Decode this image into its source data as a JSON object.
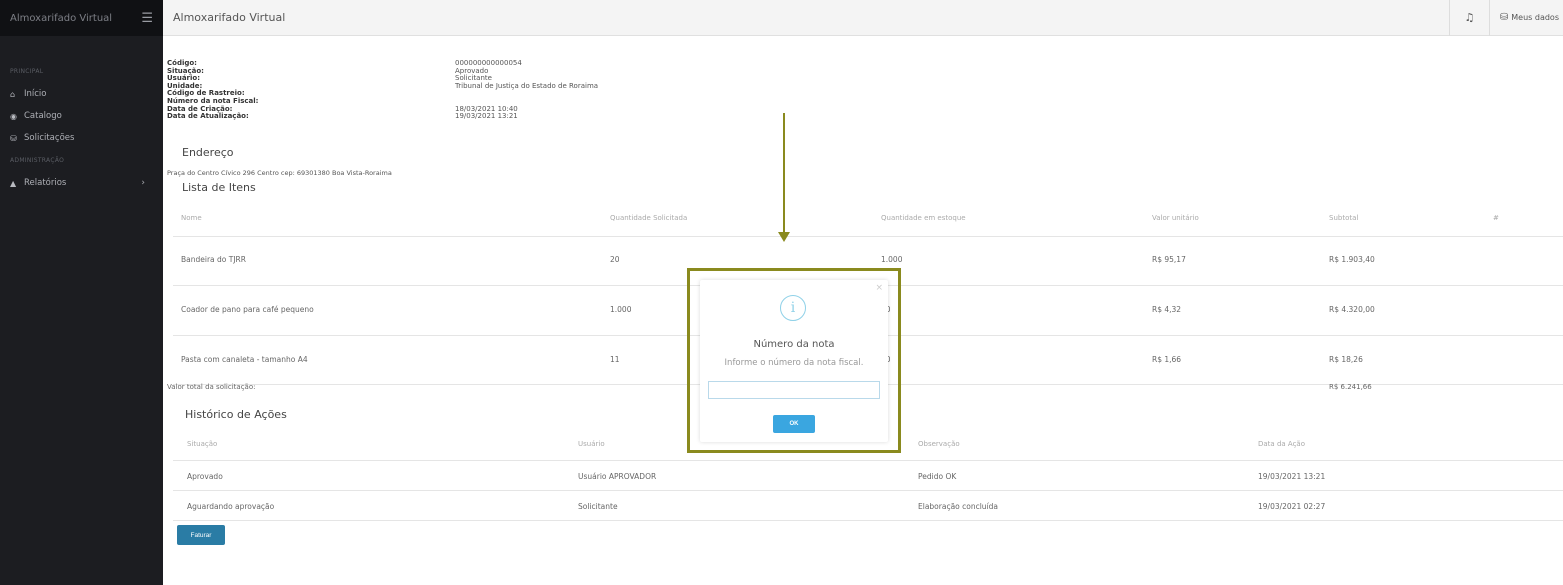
{
  "sidebar": {
    "app_name": "Almoxarifado Virtual",
    "section_principal": "PRINCIPAL",
    "section_admin": "ADMINISTRAÇÃO",
    "items": [
      {
        "label": "Início",
        "icon": "home-icon",
        "glyph": "⌂"
      },
      {
        "label": "Catalogo",
        "icon": "catalog-icon",
        "glyph": "◉"
      },
      {
        "label": "Solicitações",
        "icon": "basket-icon",
        "glyph": "⛁"
      },
      {
        "label": "Relatórios",
        "icon": "chart-icon",
        "glyph": "▲"
      }
    ]
  },
  "topbar": {
    "title": "Almoxarifado Virtual",
    "user_label": "Meus dados"
  },
  "details": {
    "labels": [
      "Código:",
      "Situação:",
      "Usuário:",
      "Unidade:",
      "Código de Rastreio:",
      "Número da nota Fiscal:",
      "Data de Criação:",
      "Data de Atualização:"
    ],
    "values": [
      "000000000000054",
      "Aprovado",
      "Solicitante",
      "Tribunal de Justiça do Estado de Roraima",
      "",
      "",
      "18/03/2021 10:40",
      "19/03/2021 13:21"
    ]
  },
  "endereco": {
    "title": "Endereço",
    "text": "Praça do Centro Cívico 296 Centro cep: 69301380 Boa Vista-Roraima"
  },
  "itens": {
    "title": "Lista de Itens",
    "headers": [
      "Nome",
      "Quantidade Solicitada",
      "Quantidade em estoque",
      "Valor unitário",
      "Subtotal",
      "#"
    ],
    "rows": [
      [
        "Bandeira do TJRR",
        "20",
        "1.000",
        "R$ 95,17",
        "R$ 1.903,40"
      ],
      [
        "Coador de pano para café pequeno",
        "1.000",
        "90",
        "R$ 4,32",
        "R$ 4.320,00"
      ],
      [
        "Pasta com canaleta - tamanho A4",
        "11",
        "70",
        "R$ 1,66",
        "R$ 18,26"
      ]
    ],
    "total_label": "Valor total da solicitação:",
    "total_value": "R$ 6.241,66"
  },
  "historico": {
    "title": "Histórico de Ações",
    "headers": [
      "Situação",
      "Usuário",
      "Observação",
      "Data da Ação"
    ],
    "rows": [
      [
        "Aprovado",
        "Usuário APROVADOR",
        "Pedido OK",
        "19/03/2021 13:21"
      ],
      [
        "Aguardando aprovação",
        "Solicitante",
        "Elaboração concluída",
        "19/03/2021 02:27"
      ]
    ]
  },
  "actions": {
    "faturar_label": "Faturar"
  },
  "modal": {
    "title": "Número da nota",
    "text": "Informe o número da nota fiscal.",
    "input_value": "",
    "ok_label": "OK",
    "close_glyph": "×",
    "icon_glyph": "i"
  },
  "colors": {
    "annotation": "#8a8a1e",
    "primary": "#2a7ca5",
    "ok": "#3aa6e0",
    "sidebar": "#1c1d21"
  }
}
